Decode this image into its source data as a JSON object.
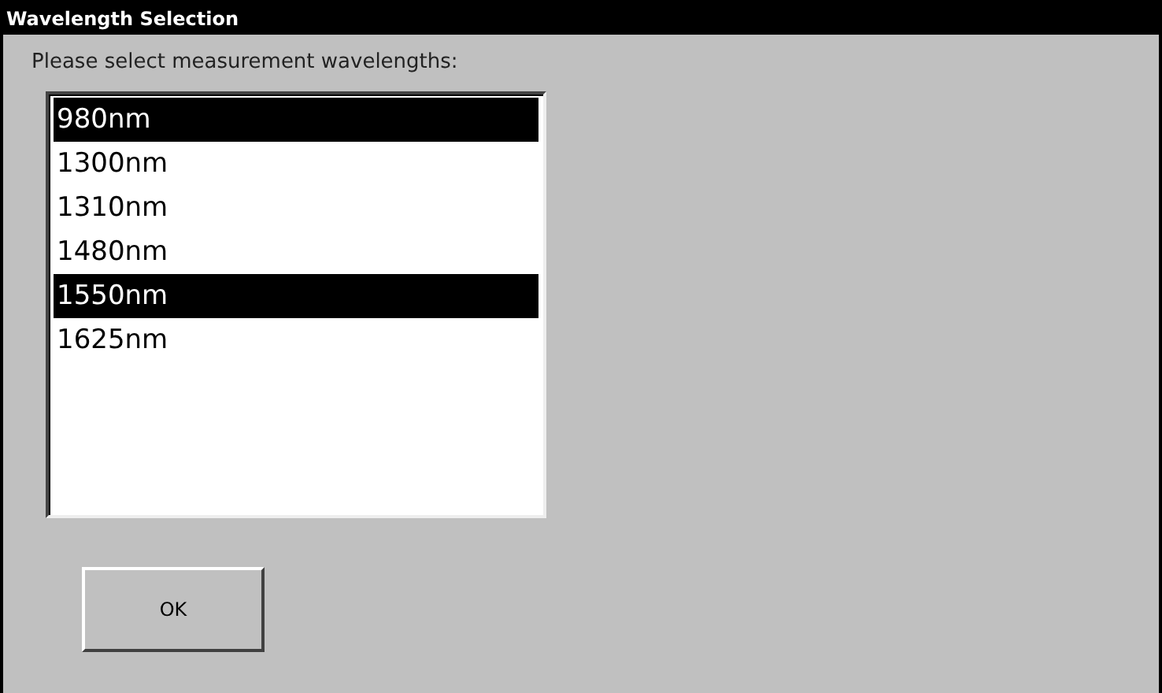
{
  "window": {
    "title": "Wavelength Selection"
  },
  "prompt": "Please select measurement wavelengths:",
  "wavelengths": [
    {
      "label": "980nm",
      "selected": true
    },
    {
      "label": "1300nm",
      "selected": false
    },
    {
      "label": "1310nm",
      "selected": false
    },
    {
      "label": "1480nm",
      "selected": false
    },
    {
      "label": "1550nm",
      "selected": true
    },
    {
      "label": "1625nm",
      "selected": false
    }
  ],
  "buttons": [
    "OK"
  ]
}
